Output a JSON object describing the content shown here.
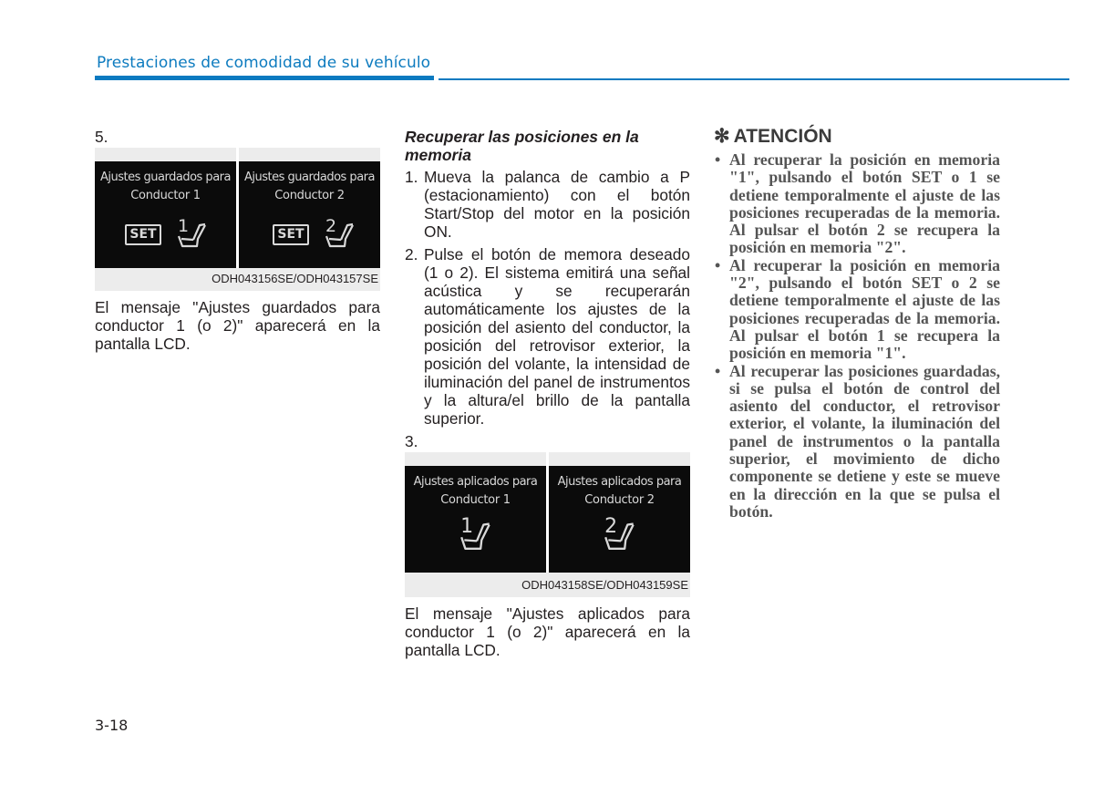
{
  "header": {
    "title": "Prestaciones de comodidad de su vehículo",
    "accent_color": "#0b7ac0"
  },
  "left_column": {
    "step_number": "5.",
    "figure": {
      "panels": [
        {
          "line1": "Ajustes guardados para",
          "line2": "Conductor 1",
          "set_label": "SET",
          "seat_number": "1",
          "icon": "seat-memory-icon"
        },
        {
          "line1": "Ajustes guardados para",
          "line2": "Conductor 2",
          "set_label": "SET",
          "seat_number": "2",
          "icon": "seat-memory-icon"
        }
      ],
      "caption": "ODH043156SE/ODH043157SE"
    },
    "paragraph": "El mensaje \"Ajustes guardados para conductor 1 (o 2)\" aparecerá en la pantalla LCD."
  },
  "middle_column": {
    "section_title": "Recuperar las posiciones en la memoria",
    "steps": [
      {
        "number": "1.",
        "text": "Mueva la palanca de cambio a P (estacionamiento) con el botón Start/Stop del motor en la posición ON."
      },
      {
        "number": "2.",
        "text": "Pulse el botón de memora deseado (1 o 2). El sistema emitirá una señal acústica y se recuperarán automáticamente los ajustes de la posición del asiento del conductor, la posición del retrovisor exterior, la posición del volante, la intensidad de iluminación del panel de instrumentos y la altura/el brillo de la pantalla superior."
      }
    ],
    "step3_number": "3.",
    "figure": {
      "panels": [
        {
          "line1": "Ajustes aplicados para",
          "line2": "Conductor 1",
          "seat_number": "1",
          "icon": "seat-memory-icon"
        },
        {
          "line1": "Ajustes aplicados para",
          "line2": "Conductor 2",
          "seat_number": "2",
          "icon": "seat-memory-icon"
        }
      ],
      "caption": "ODH043158SE/ODH043159SE"
    },
    "paragraph": "El mensaje \"Ajustes aplicados para conductor 1 (o 2)\" aparecerá en la pantalla LCD."
  },
  "right_column": {
    "attention_icon": "asterisk-icon",
    "attention_star": "✻",
    "attention_title": "ATENCIÓN",
    "bullets": [
      "Al recuperar la posición en memoria \"1\", pulsando el botón SET o 1 se detiene temporalmente el ajuste de las posiciones recuperadas de la memoria. Al pulsar el botón 2 se recupera la posición en memoria \"2\".",
      "Al recuperar la posición en memoria \"2\", pulsando el botón SET o 2 se detiene temporalmente el ajuste de las posiciones recuperadas de la memoria. Al pulsar el botón 1 se recupera la posición en memoria \"1\".",
      "Al recuperar las posiciones guardadas, si se pulsa el botón de control del asiento del conductor, el retrovisor exterior, el volante, la iluminación del panel de instrumentos o la pantalla superior, el movimiento de dicho componente se detiene y este se mueve en la dirección en la que se pulsa el botón."
    ],
    "bullet_glyph": "•"
  },
  "footer": {
    "page_number": "3-18"
  }
}
